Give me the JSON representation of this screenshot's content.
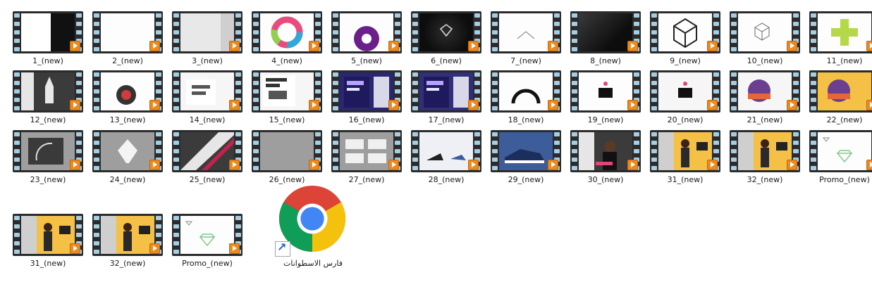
{
  "videos_row1": [
    {
      "label": "1_(new)",
      "thumb": "t-bw"
    },
    {
      "label": "2_(new)",
      "thumb": "t-white"
    },
    {
      "label": "3_(new)",
      "thumb": "t-gray"
    },
    {
      "label": "4_(new)",
      "thumb": "t-white",
      "art": "ring"
    },
    {
      "label": "5_(new)",
      "thumb": "t-white",
      "art": "purple"
    },
    {
      "label": "6_(new)",
      "thumb": "t-dark",
      "art": "diamond"
    },
    {
      "label": "7_(new)",
      "thumb": "t-white",
      "art": "line"
    },
    {
      "label": "8_(new)",
      "thumb": "t-blackcard"
    },
    {
      "label": "9_(new)",
      "thumb": "t-white",
      "art": "hex"
    },
    {
      "label": "10_(new)",
      "thumb": "t-white",
      "art": "cube"
    },
    {
      "label": "11_(new)",
      "thumb": "t-white",
      "art": "plus"
    }
  ],
  "videos_row2": [
    {
      "label": "12_(new)",
      "thumb": "t-dark2",
      "art": "rocket"
    },
    {
      "label": "13_(new)",
      "thumb": "t-white",
      "art": "badge"
    },
    {
      "label": "14_(new)",
      "thumb": "t-white2",
      "art": "sample"
    },
    {
      "label": "15_(new)",
      "thumb": "t-white2",
      "art": "headline"
    },
    {
      "label": "16_(new)",
      "thumb": "t-navy",
      "art": "festival"
    },
    {
      "label": "17_(new)",
      "thumb": "t-navy2",
      "art": "festival"
    },
    {
      "label": "18_(new)",
      "thumb": "t-white",
      "art": "arc"
    },
    {
      "label": "19_(new)",
      "thumb": "t-white",
      "art": "cup"
    },
    {
      "label": "20_(new)",
      "thumb": "t-white2",
      "art": "cup"
    },
    {
      "label": "21_(new)",
      "thumb": "t-white2",
      "art": "coffee"
    },
    {
      "label": "22_(new)",
      "thumb": "t-yellow",
      "art": "coffee"
    }
  ],
  "videos_row3": [
    {
      "label": "23_(new)",
      "thumb": "t-gray2",
      "art": "arcdark"
    },
    {
      "label": "24_(new)",
      "thumb": "t-gray2",
      "art": "pen"
    },
    {
      "label": "25_(new)",
      "thumb": "t-dark2",
      "art": "stripe"
    },
    {
      "label": "26_(new)",
      "thumb": "t-gray2"
    },
    {
      "label": "27_(new)",
      "thumb": "t-gray2",
      "art": "grid"
    },
    {
      "label": "28_(new)",
      "thumb": "t-shoe",
      "art": "heel"
    },
    {
      "label": "29_(new)",
      "thumb": "t-shoe2",
      "art": "sneaker"
    },
    {
      "label": "30_(new)",
      "thumb": "t-dark2",
      "art": "person"
    },
    {
      "label": "31_(new)",
      "thumb": "t-yellow",
      "art": "model"
    },
    {
      "label": "32_(new)",
      "thumb": "t-yellow",
      "art": "model"
    },
    {
      "label": "Promo_(new)",
      "thumb": "t-white",
      "art": "gem"
    }
  ],
  "videos_row4": [
    {
      "label": "31_(new)",
      "thumb": "t-yellow",
      "art": "model"
    },
    {
      "label": "32_(new)",
      "thumb": "t-yellow",
      "art": "model"
    },
    {
      "label": "Promo_(new)",
      "thumb": "t-white",
      "art": "gem"
    }
  ],
  "shortcut": {
    "label": "فارس الاسطوانات",
    "icon": "chrome-icon"
  }
}
